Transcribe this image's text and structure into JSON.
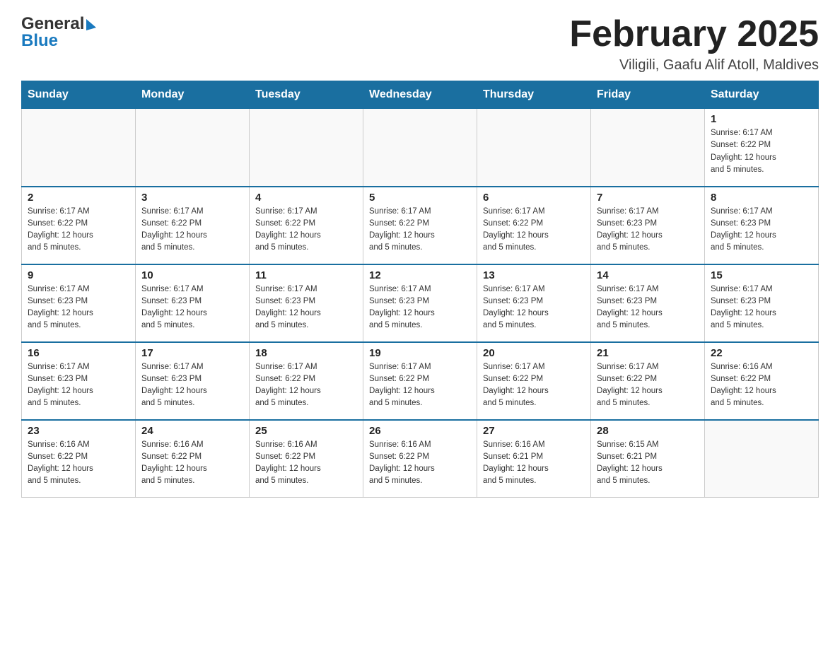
{
  "header": {
    "logo_general": "General",
    "logo_blue": "Blue",
    "title": "February 2025",
    "location": "Viligili, Gaafu Alif Atoll, Maldives"
  },
  "days_of_week": [
    "Sunday",
    "Monday",
    "Tuesday",
    "Wednesday",
    "Thursday",
    "Friday",
    "Saturday"
  ],
  "weeks": [
    {
      "days": [
        {
          "number": "",
          "info": ""
        },
        {
          "number": "",
          "info": ""
        },
        {
          "number": "",
          "info": ""
        },
        {
          "number": "",
          "info": ""
        },
        {
          "number": "",
          "info": ""
        },
        {
          "number": "",
          "info": ""
        },
        {
          "number": "1",
          "info": "Sunrise: 6:17 AM\nSunset: 6:22 PM\nDaylight: 12 hours\nand 5 minutes."
        }
      ]
    },
    {
      "days": [
        {
          "number": "2",
          "info": "Sunrise: 6:17 AM\nSunset: 6:22 PM\nDaylight: 12 hours\nand 5 minutes."
        },
        {
          "number": "3",
          "info": "Sunrise: 6:17 AM\nSunset: 6:22 PM\nDaylight: 12 hours\nand 5 minutes."
        },
        {
          "number": "4",
          "info": "Sunrise: 6:17 AM\nSunset: 6:22 PM\nDaylight: 12 hours\nand 5 minutes."
        },
        {
          "number": "5",
          "info": "Sunrise: 6:17 AM\nSunset: 6:22 PM\nDaylight: 12 hours\nand 5 minutes."
        },
        {
          "number": "6",
          "info": "Sunrise: 6:17 AM\nSunset: 6:22 PM\nDaylight: 12 hours\nand 5 minutes."
        },
        {
          "number": "7",
          "info": "Sunrise: 6:17 AM\nSunset: 6:23 PM\nDaylight: 12 hours\nand 5 minutes."
        },
        {
          "number": "8",
          "info": "Sunrise: 6:17 AM\nSunset: 6:23 PM\nDaylight: 12 hours\nand 5 minutes."
        }
      ]
    },
    {
      "days": [
        {
          "number": "9",
          "info": "Sunrise: 6:17 AM\nSunset: 6:23 PM\nDaylight: 12 hours\nand 5 minutes."
        },
        {
          "number": "10",
          "info": "Sunrise: 6:17 AM\nSunset: 6:23 PM\nDaylight: 12 hours\nand 5 minutes."
        },
        {
          "number": "11",
          "info": "Sunrise: 6:17 AM\nSunset: 6:23 PM\nDaylight: 12 hours\nand 5 minutes."
        },
        {
          "number": "12",
          "info": "Sunrise: 6:17 AM\nSunset: 6:23 PM\nDaylight: 12 hours\nand 5 minutes."
        },
        {
          "number": "13",
          "info": "Sunrise: 6:17 AM\nSunset: 6:23 PM\nDaylight: 12 hours\nand 5 minutes."
        },
        {
          "number": "14",
          "info": "Sunrise: 6:17 AM\nSunset: 6:23 PM\nDaylight: 12 hours\nand 5 minutes."
        },
        {
          "number": "15",
          "info": "Sunrise: 6:17 AM\nSunset: 6:23 PM\nDaylight: 12 hours\nand 5 minutes."
        }
      ]
    },
    {
      "days": [
        {
          "number": "16",
          "info": "Sunrise: 6:17 AM\nSunset: 6:23 PM\nDaylight: 12 hours\nand 5 minutes."
        },
        {
          "number": "17",
          "info": "Sunrise: 6:17 AM\nSunset: 6:23 PM\nDaylight: 12 hours\nand 5 minutes."
        },
        {
          "number": "18",
          "info": "Sunrise: 6:17 AM\nSunset: 6:22 PM\nDaylight: 12 hours\nand 5 minutes."
        },
        {
          "number": "19",
          "info": "Sunrise: 6:17 AM\nSunset: 6:22 PM\nDaylight: 12 hours\nand 5 minutes."
        },
        {
          "number": "20",
          "info": "Sunrise: 6:17 AM\nSunset: 6:22 PM\nDaylight: 12 hours\nand 5 minutes."
        },
        {
          "number": "21",
          "info": "Sunrise: 6:17 AM\nSunset: 6:22 PM\nDaylight: 12 hours\nand 5 minutes."
        },
        {
          "number": "22",
          "info": "Sunrise: 6:16 AM\nSunset: 6:22 PM\nDaylight: 12 hours\nand 5 minutes."
        }
      ]
    },
    {
      "days": [
        {
          "number": "23",
          "info": "Sunrise: 6:16 AM\nSunset: 6:22 PM\nDaylight: 12 hours\nand 5 minutes."
        },
        {
          "number": "24",
          "info": "Sunrise: 6:16 AM\nSunset: 6:22 PM\nDaylight: 12 hours\nand 5 minutes."
        },
        {
          "number": "25",
          "info": "Sunrise: 6:16 AM\nSunset: 6:22 PM\nDaylight: 12 hours\nand 5 minutes."
        },
        {
          "number": "26",
          "info": "Sunrise: 6:16 AM\nSunset: 6:22 PM\nDaylight: 12 hours\nand 5 minutes."
        },
        {
          "number": "27",
          "info": "Sunrise: 6:16 AM\nSunset: 6:21 PM\nDaylight: 12 hours\nand 5 minutes."
        },
        {
          "number": "28",
          "info": "Sunrise: 6:15 AM\nSunset: 6:21 PM\nDaylight: 12 hours\nand 5 minutes."
        },
        {
          "number": "",
          "info": ""
        }
      ]
    }
  ]
}
